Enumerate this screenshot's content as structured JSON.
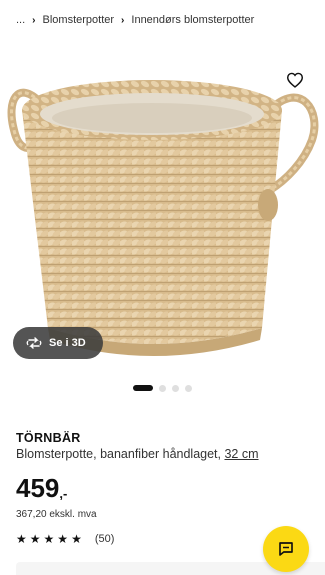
{
  "breadcrumb": {
    "ellipsis": "...",
    "items": [
      {
        "label": "Blomsterpotter"
      },
      {
        "label": "Innendørs blomsterpotter"
      }
    ],
    "separator": "›"
  },
  "gallery": {
    "view_3d_label": "Se i 3D",
    "image_count": 4,
    "active_index": 0
  },
  "product": {
    "name": "TÖRNBÄR",
    "description": "Blomsterpotte, bananfiber håndlaget,",
    "size": "32 cm",
    "price_main": "459",
    "price_suffix": ",-",
    "price_ex_vat": "367,20 ekskl. mva",
    "rating_stars": 5,
    "review_count": "(50)"
  },
  "icons": {
    "favorite": "heart-icon",
    "rotate_3d": "rotate-3d-icon",
    "chat": "chat-icon",
    "star": "star-icon"
  },
  "colors": {
    "chat_button": "#fbd914",
    "view_3d_button": "#3c3c3c",
    "dot_active": "#111111",
    "dot_inactive": "#dfdfdf"
  }
}
